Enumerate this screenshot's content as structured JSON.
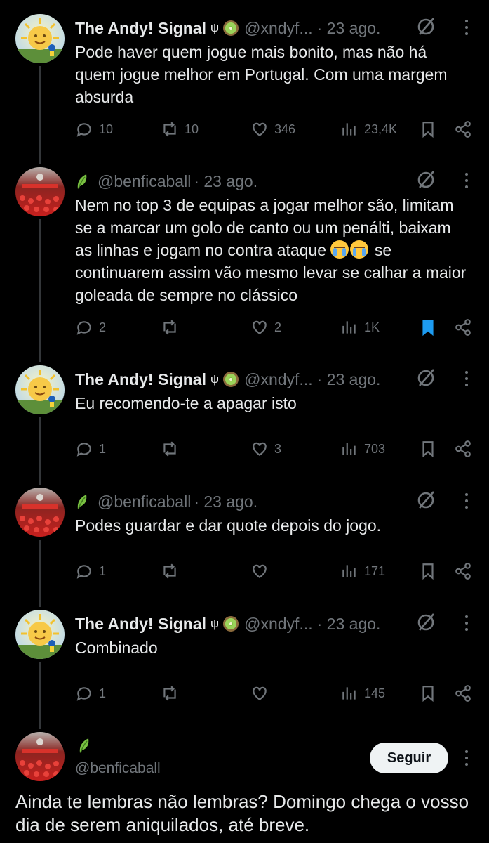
{
  "tweets": [
    {
      "avatar": "sun-avatar",
      "name": "The Andy! Signal",
      "badge": "ψ",
      "emoji_badge": "kiwi-icon",
      "handle": "@xndyf...",
      "date": "· 23 ago.",
      "text": "Pode haver quem jogue mais bonito, mas não há quem jogue melhor em Portugal. Com uma margem absurda",
      "replies": "10",
      "retweets": "10",
      "likes": "346",
      "views": "23,4K",
      "bookmarked": false
    },
    {
      "avatar": "crowd-avatar",
      "name": "",
      "emoji_badge": "leaf-icon",
      "handle": "@benficaball",
      "date": "· 23 ago.",
      "text": "Nem no top 3 de equipas a jogar melhor são, limitam se a marcar um golo de canto ou um penálti, baixam as linhas e jogam no contra ataque",
      "text_tail": "se continuarem assim vão mesmo levar se calhar a maior goleada de sempre no clássico",
      "replies": "2",
      "retweets": "",
      "likes": "2",
      "views": "1K",
      "bookmarked": true
    },
    {
      "avatar": "sun-avatar",
      "name": "The Andy! Signal",
      "badge": "ψ",
      "emoji_badge": "kiwi-icon",
      "handle": "@xndyf...",
      "date": "· 23 ago.",
      "text": "Eu recomendo-te a apagar isto",
      "replies": "1",
      "retweets": "",
      "likes": "3",
      "views": "703",
      "bookmarked": false
    },
    {
      "avatar": "crowd-avatar",
      "name": "",
      "emoji_badge": "leaf-icon",
      "handle": "@benficaball",
      "date": "· 23 ago.",
      "text": "Podes guardar e dar quote depois do jogo.",
      "replies": "1",
      "retweets": "",
      "likes": "",
      "views": "171",
      "bookmarked": false
    },
    {
      "avatar": "sun-avatar",
      "name": "The Andy! Signal",
      "badge": "ψ",
      "emoji_badge": "kiwi-icon",
      "handle": "@xndyf...",
      "date": "· 23 ago.",
      "text": "Combinado",
      "replies": "1",
      "retweets": "",
      "likes": "",
      "views": "145",
      "bookmarked": false
    }
  ],
  "main_tweet": {
    "avatar": "crowd-avatar",
    "emoji_badge": "leaf-icon",
    "handle": "@benficaball",
    "follow_label": "Seguir",
    "text": "Ainda te lembras não lembras? Domingo chega o vosso dia de serem aniquilados, até breve."
  },
  "colors": {
    "background": "#000000",
    "text": "#e7e9ea",
    "muted": "#71767b",
    "bookmark_active": "#1d9bf0",
    "thread_line": "#333639"
  }
}
